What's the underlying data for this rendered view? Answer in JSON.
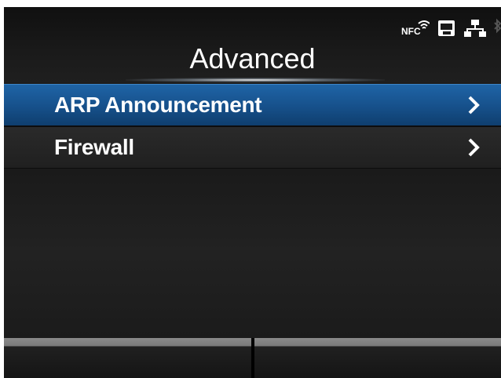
{
  "header": {
    "title": "Advanced",
    "status_icons": [
      "nfc-icon",
      "sd-card-icon",
      "network-icon",
      "bluetooth-icon"
    ],
    "nfc_label": "NFC"
  },
  "menu": {
    "items": [
      {
        "label": "ARP Announcement",
        "selected": true,
        "icon": "chevron-right-icon"
      },
      {
        "label": "Firewall",
        "selected": false,
        "icon": "chevron-right-icon"
      }
    ]
  },
  "softkeys": {
    "left_label": "",
    "right_label": ""
  },
  "colors": {
    "selected_row": "#1a5a98",
    "background": "#1d1d1d",
    "text": "#ffffff"
  }
}
